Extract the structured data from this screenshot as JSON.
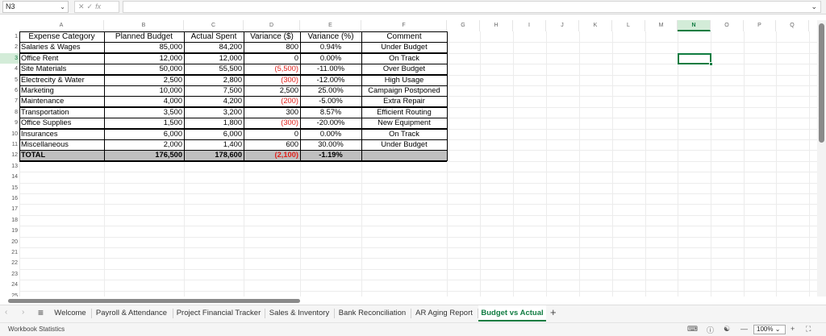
{
  "formula_bar": {
    "name_box": "N3",
    "icons": [
      "cancel-icon",
      "confirm-icon",
      "function-icon"
    ],
    "formula": ""
  },
  "columns": [
    "A",
    "B",
    "C",
    "D",
    "E",
    "F",
    "G",
    "H",
    "I",
    "J",
    "K",
    "L",
    "M",
    "N",
    "O",
    "P",
    "Q"
  ],
  "selected_column": "N",
  "selected_row": 3,
  "rows": [
    "1",
    "2",
    "3",
    "4",
    "5",
    "6",
    "7",
    "8",
    "9",
    "10",
    "11",
    "12",
    "13",
    "14",
    "15",
    "16",
    "17",
    "18",
    "19",
    "20",
    "21",
    "22",
    "23",
    "24",
    "25"
  ],
  "table": {
    "headers": [
      "Expense Category",
      "Planned Budget",
      "Actual Spent",
      "Variance ($)",
      "Variance (%)",
      "Comment"
    ],
    "rows": [
      [
        "Salaries & Wages",
        "85,000",
        "84,200",
        "800",
        "0.94%",
        "Under Budget"
      ],
      [
        "Office Rent",
        "12,000",
        "12,000",
        "0",
        "0.00%",
        "On Track"
      ],
      [
        "Site Materials",
        "50,000",
        "55,500",
        "(5,500)",
        "-11.00%",
        "Over Budget"
      ],
      [
        "Electrecity & Water",
        "2,500",
        "2,800",
        "(300)",
        "-12.00%",
        "High Usage"
      ],
      [
        "Marketing",
        "10,000",
        "7,500",
        "2,500",
        "25.00%",
        "Campaign Postponed"
      ],
      [
        "Maintenance",
        "4,000",
        "4,200",
        "(200)",
        "-5.00%",
        "Extra Repair"
      ],
      [
        "Transportation",
        "3,500",
        "3,200",
        "300",
        "8.57%",
        "Efficient Routing"
      ],
      [
        "Office Supplies",
        "1,500",
        "1,800",
        "(300)",
        "-20.00%",
        "New Equipment"
      ],
      [
        "Insurances",
        "6,000",
        "6,000",
        "0",
        "0.00%",
        "On Track"
      ],
      [
        "Miscellaneous",
        "2,000",
        "1,400",
        "600",
        "30.00%",
        "Under Budget"
      ]
    ],
    "total": [
      "TOTAL",
      "176,500",
      "178,600",
      "(2,100)",
      "-1.19%",
      ""
    ]
  },
  "tabs": [
    "Welcome",
    "Payroll & Attendance",
    "Project Financial Tracker",
    "Sales & Inventory",
    "Bank Reconciliation",
    "AR Aging Report",
    "Budget vs Actual"
  ],
  "active_tab": "Budget vs Actual",
  "status": {
    "left_text": "Workbook Statistics",
    "zoom": "100%"
  },
  "colors": {
    "accent": "#107c41",
    "negative": "#e0201b",
    "total_fill": "#bfbfbf"
  }
}
